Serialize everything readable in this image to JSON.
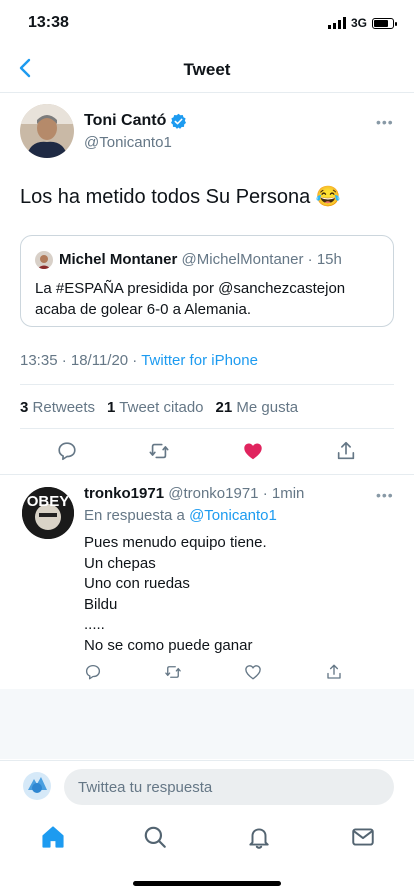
{
  "status_bar": {
    "time": "13:38",
    "network": "3G"
  },
  "nav": {
    "title": "Tweet"
  },
  "tweet": {
    "author_name": "Toni Cantó",
    "author_handle": "@Tonicanto1",
    "text": "Los ha metido todos Su Persona 😂",
    "quoted": {
      "name": "Michel Montaner",
      "handle": "@MichelMontaner",
      "age": "· 15h",
      "text": "La #ESPAÑA presidida por @sanchezcastejon acaba de golear 6-0 a Alemania."
    },
    "timestamp": "13:35 · 18/11/20 ·",
    "source": "Twitter for iPhone",
    "stats": {
      "retweets_count": "3",
      "retweets_label": "Retweets",
      "quotes_count": "1",
      "quotes_label": "Tweet citado",
      "likes_count": "21",
      "likes_label": "Me gusta"
    }
  },
  "reply": {
    "name": "tronko1971",
    "handle": "@tronko1971",
    "age": "· 1min",
    "reply_prefix": "En respuesta a",
    "reply_to": "@Tonicanto1",
    "avatar_text": "OBEY",
    "lines": [
      "Pues menudo equipo tiene.",
      "Un chepas",
      "Uno con ruedas",
      "Bildu",
      ".....",
      "No se como puede ganar"
    ]
  },
  "compose": {
    "placeholder": "Twittea tu respuesta"
  },
  "colors": {
    "accent": "#1d9bf0",
    "like": "#e0245e",
    "secondary_text": "#657786"
  },
  "icons": {
    "tweet_actions": [
      "reply-icon",
      "retweet-icon",
      "like-filled-icon",
      "share-icon"
    ],
    "tab_bar": [
      "home-icon",
      "search-icon",
      "notifications-icon",
      "messages-icon"
    ]
  }
}
